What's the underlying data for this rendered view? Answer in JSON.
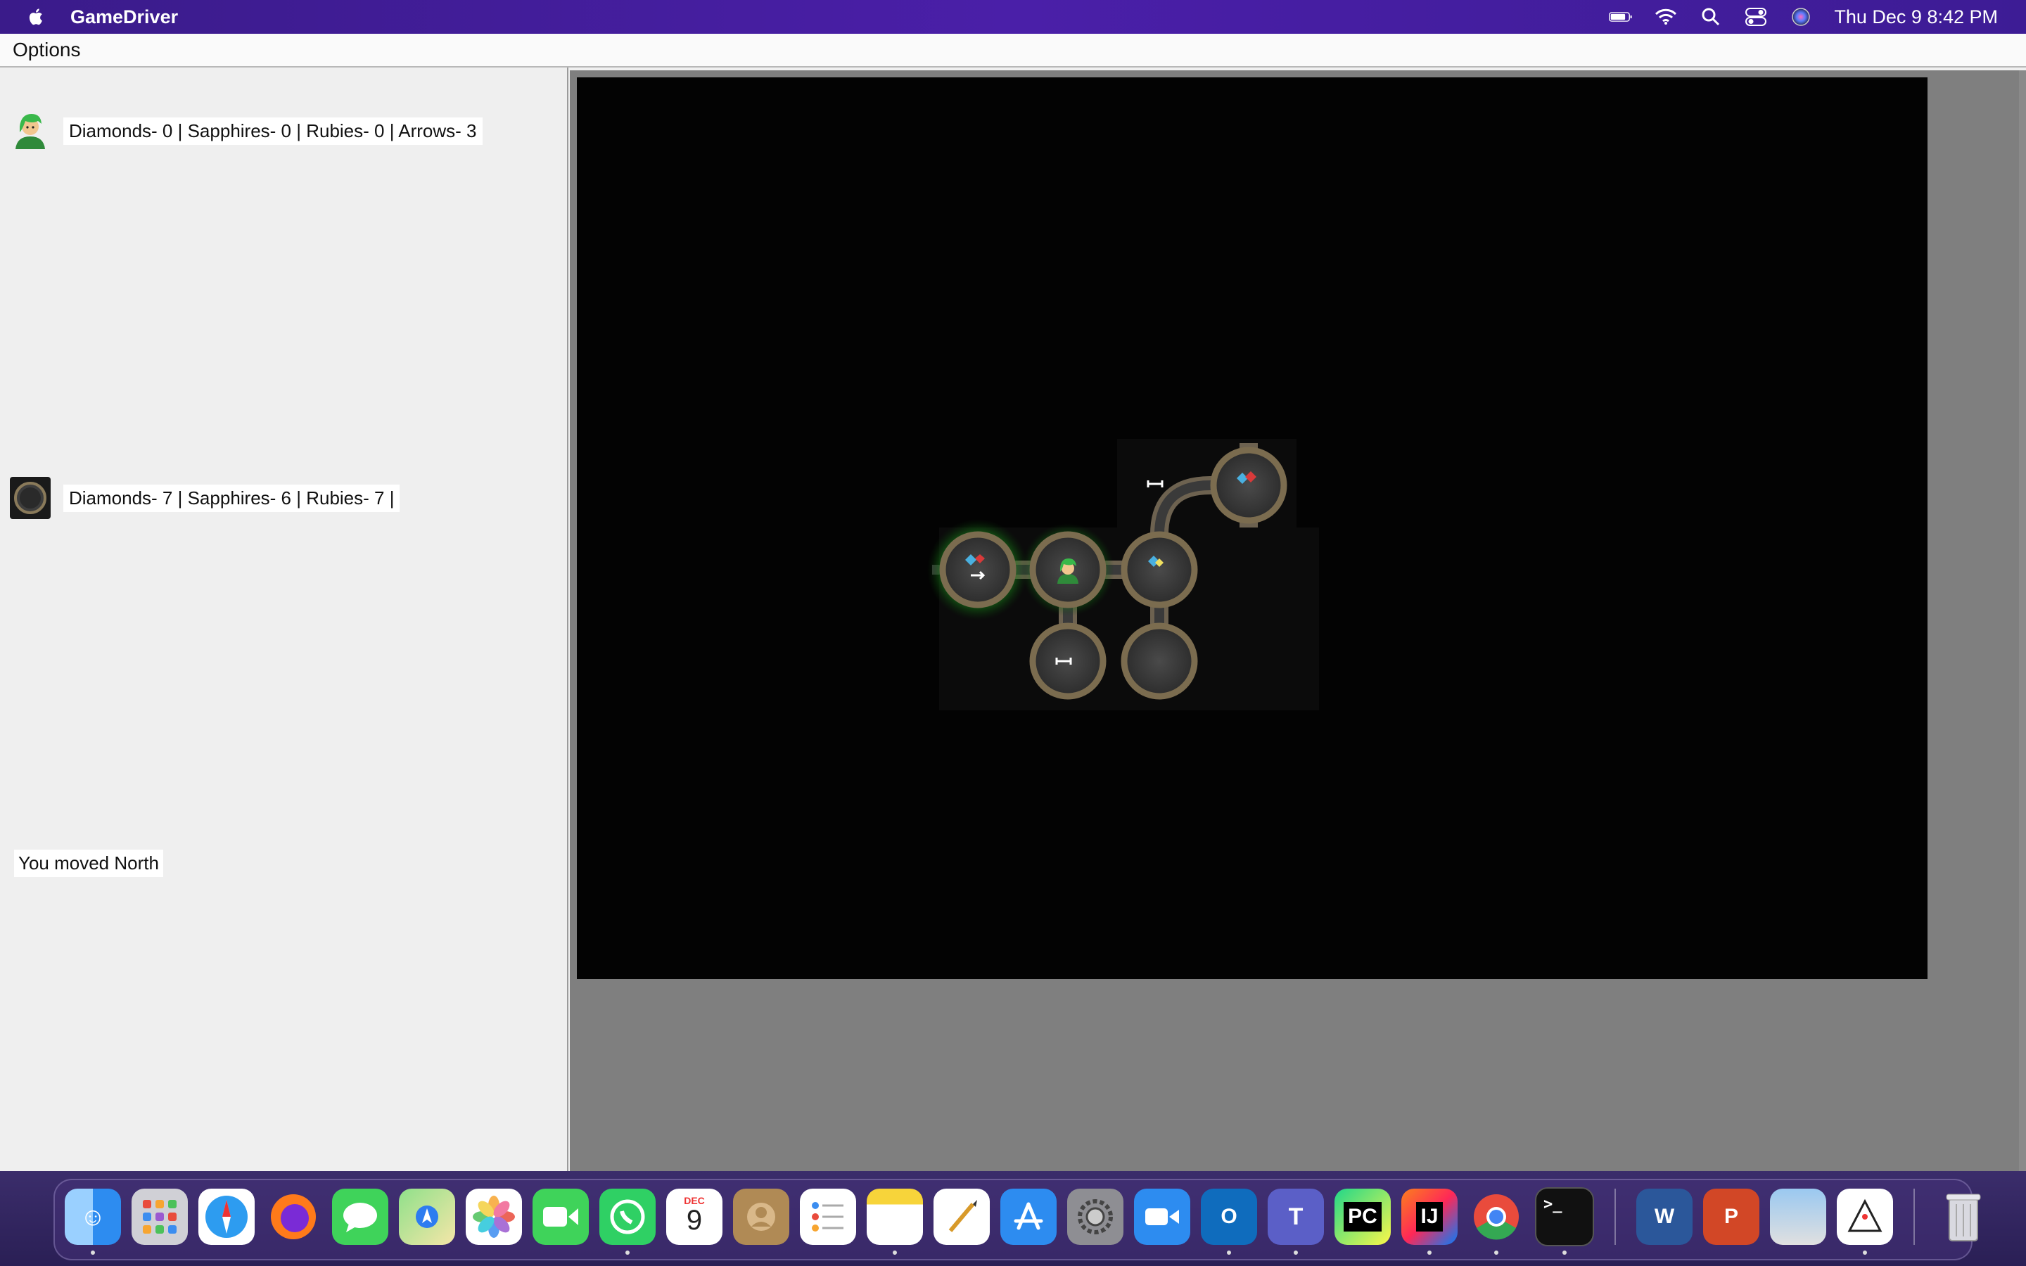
{
  "menubar": {
    "app_name": "GameDriver",
    "clock": "Thu Dec 9  8:42 PM",
    "icons": [
      "apple-icon",
      "battery-icon",
      "wifi-icon",
      "spotlight-search-icon",
      "control-center-icon",
      "siri-icon"
    ]
  },
  "window": {
    "menu": {
      "options_label": "Options"
    },
    "player_stats": {
      "text": "Diamonds- 0 | Sapphires- 0 | Rubies- 0 | Arrows- 3",
      "icon": "adventurer-icon"
    },
    "room_stats": {
      "text": "Diamonds- 7 | Sapphires- 6 | Rubies- 7 |",
      "icon": "room-thumbnail-icon"
    },
    "message": "You moved North"
  },
  "map": {
    "background": "#030303",
    "rooms": [
      "room-west-highlighted",
      "room-player-current",
      "room-east",
      "room-northeast",
      "room-south-left",
      "room-south-right"
    ],
    "items": [
      "gem-cluster-icon",
      "arrow-item-icon",
      "gem-cluster-icon",
      "gem-cluster-icon",
      "arrow-item-icon",
      "arrow-item-icon"
    ]
  },
  "dock": {
    "calendar": {
      "month": "DEC",
      "day": "9"
    },
    "apps": [
      "finder-icon",
      "launchpad-icon",
      "safari-icon",
      "firefox-icon",
      "messages-icon",
      "maps-icon",
      "photos-icon",
      "facetime-icon",
      "whatsapp-icon",
      "calendar-icon",
      "contacts-icon",
      "reminders-icon",
      "notes-icon",
      "script-editor-icon",
      "app-store-icon",
      "system-preferences-icon",
      "zoom-icon",
      "outlook-icon",
      "teams-icon",
      "pycharm-icon",
      "intellij-icon",
      "chrome-icon",
      "terminal-icon",
      "word-icon",
      "powerpoint-icon",
      "preview-icon",
      "java-icon",
      "trash-icon"
    ],
    "labels": {
      "pycharm": "PC",
      "intellij": "IJ",
      "word": "W",
      "powerpoint": "P",
      "terminal": ">_",
      "outlook": "O"
    }
  }
}
